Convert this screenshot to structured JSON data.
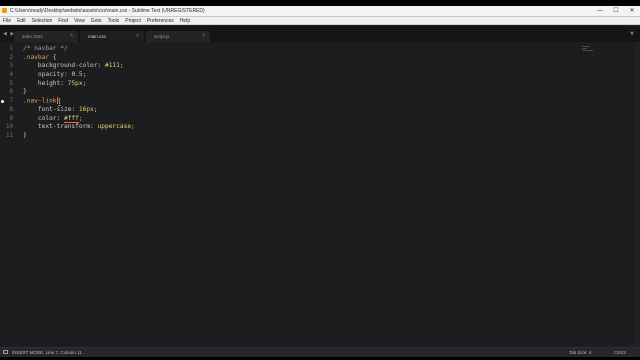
{
  "window": {
    "title": "C:\\Users\\ready\\Desktop\\website\\assets\\css\\main.css - Sublime Text (UNREGISTERED)",
    "controls": {
      "minimize": "—",
      "maximize": "☐",
      "close": "✕"
    }
  },
  "menu": {
    "items": [
      "File",
      "Edit",
      "Selection",
      "Find",
      "View",
      "Goto",
      "Tools",
      "Project",
      "Preferences",
      "Help"
    ]
  },
  "tabs": {
    "nav_arrows": "◀ ▶",
    "items": [
      {
        "label": "index.html",
        "close": "×",
        "active": false
      },
      {
        "label": "main.css",
        "close": "×",
        "active": true
      },
      {
        "label": "script.js",
        "close": "×",
        "active": false
      }
    ],
    "dropdown": "▼"
  },
  "editor": {
    "line_numbers": [
      "1",
      "2",
      "3",
      "4",
      "5",
      "6",
      "7",
      "8",
      "9",
      "10",
      "11"
    ],
    "lines": [
      {
        "text": "/* navbar */"
      },
      {
        "selector": ".navbar",
        "brace": " {"
      },
      {
        "prop": "    background-color",
        "punct": ": ",
        "value": "#111",
        "end": ";"
      },
      {
        "prop": "    opacity",
        "punct": ": ",
        "value": "0.5",
        "end": ";"
      },
      {
        "prop": "    height",
        "punct": ": ",
        "value": "75px",
        "end": ";"
      },
      {
        "text": "}"
      },
      {
        "selector": ".nav-link",
        "brace": "{"
      },
      {
        "prop": "    font-size",
        "punct": ": ",
        "value": "16px",
        "end": ";"
      },
      {
        "prop": "    color",
        "punct": ": ",
        "value": "#fff",
        "end": ";"
      },
      {
        "prop": "    text-transform",
        "punct": ": ",
        "value": "uppercase",
        "end": ";"
      },
      {
        "text": "}"
      }
    ]
  },
  "status": {
    "left": "INSERT MODE, Line 7, Column 11",
    "tab_size": "Tab Size: 4",
    "syntax": "CSS3"
  },
  "colors": {
    "background": "#1b1d1f",
    "selector": "#f0a04b",
    "value": "#e6d36b",
    "cursor": "#e06c4c"
  }
}
